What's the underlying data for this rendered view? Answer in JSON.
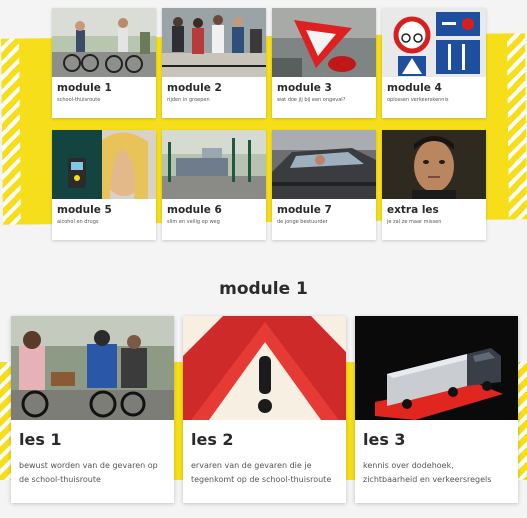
{
  "modules": [
    {
      "title": "module 1",
      "subtitle": "school-thuisroute"
    },
    {
      "title": "module 2",
      "subtitle": "rijden in groepen"
    },
    {
      "title": "module 3",
      "subtitle": "wat doe jij bij een ongeval?"
    },
    {
      "title": "module 4",
      "subtitle": "oplossen verkeerskennis"
    },
    {
      "title": "module 5",
      "subtitle": "alcohol en drugs"
    },
    {
      "title": "module 6",
      "subtitle": "slim en veilig op weg"
    },
    {
      "title": "module 7",
      "subtitle": "de jonge bestuurder"
    },
    {
      "title": "extra les",
      "subtitle": "je zal ze maar missen"
    }
  ],
  "section": {
    "title": "module 1"
  },
  "lessons": [
    {
      "title": "les 1",
      "description": "bewust worden van de gevaren op de school-thuisroute"
    },
    {
      "title": "les 2",
      "description": "ervaren van de gevaren die je tegenkomt op de school-thuisroute"
    },
    {
      "title": "les 3",
      "description": "kennis over dodehoek, zichtbaarheid en verkeersregels"
    }
  ],
  "colors": {
    "accent_yellow": "#f6df1a",
    "card_bg": "#ffffff",
    "page_bg": "#f4f4f4"
  }
}
